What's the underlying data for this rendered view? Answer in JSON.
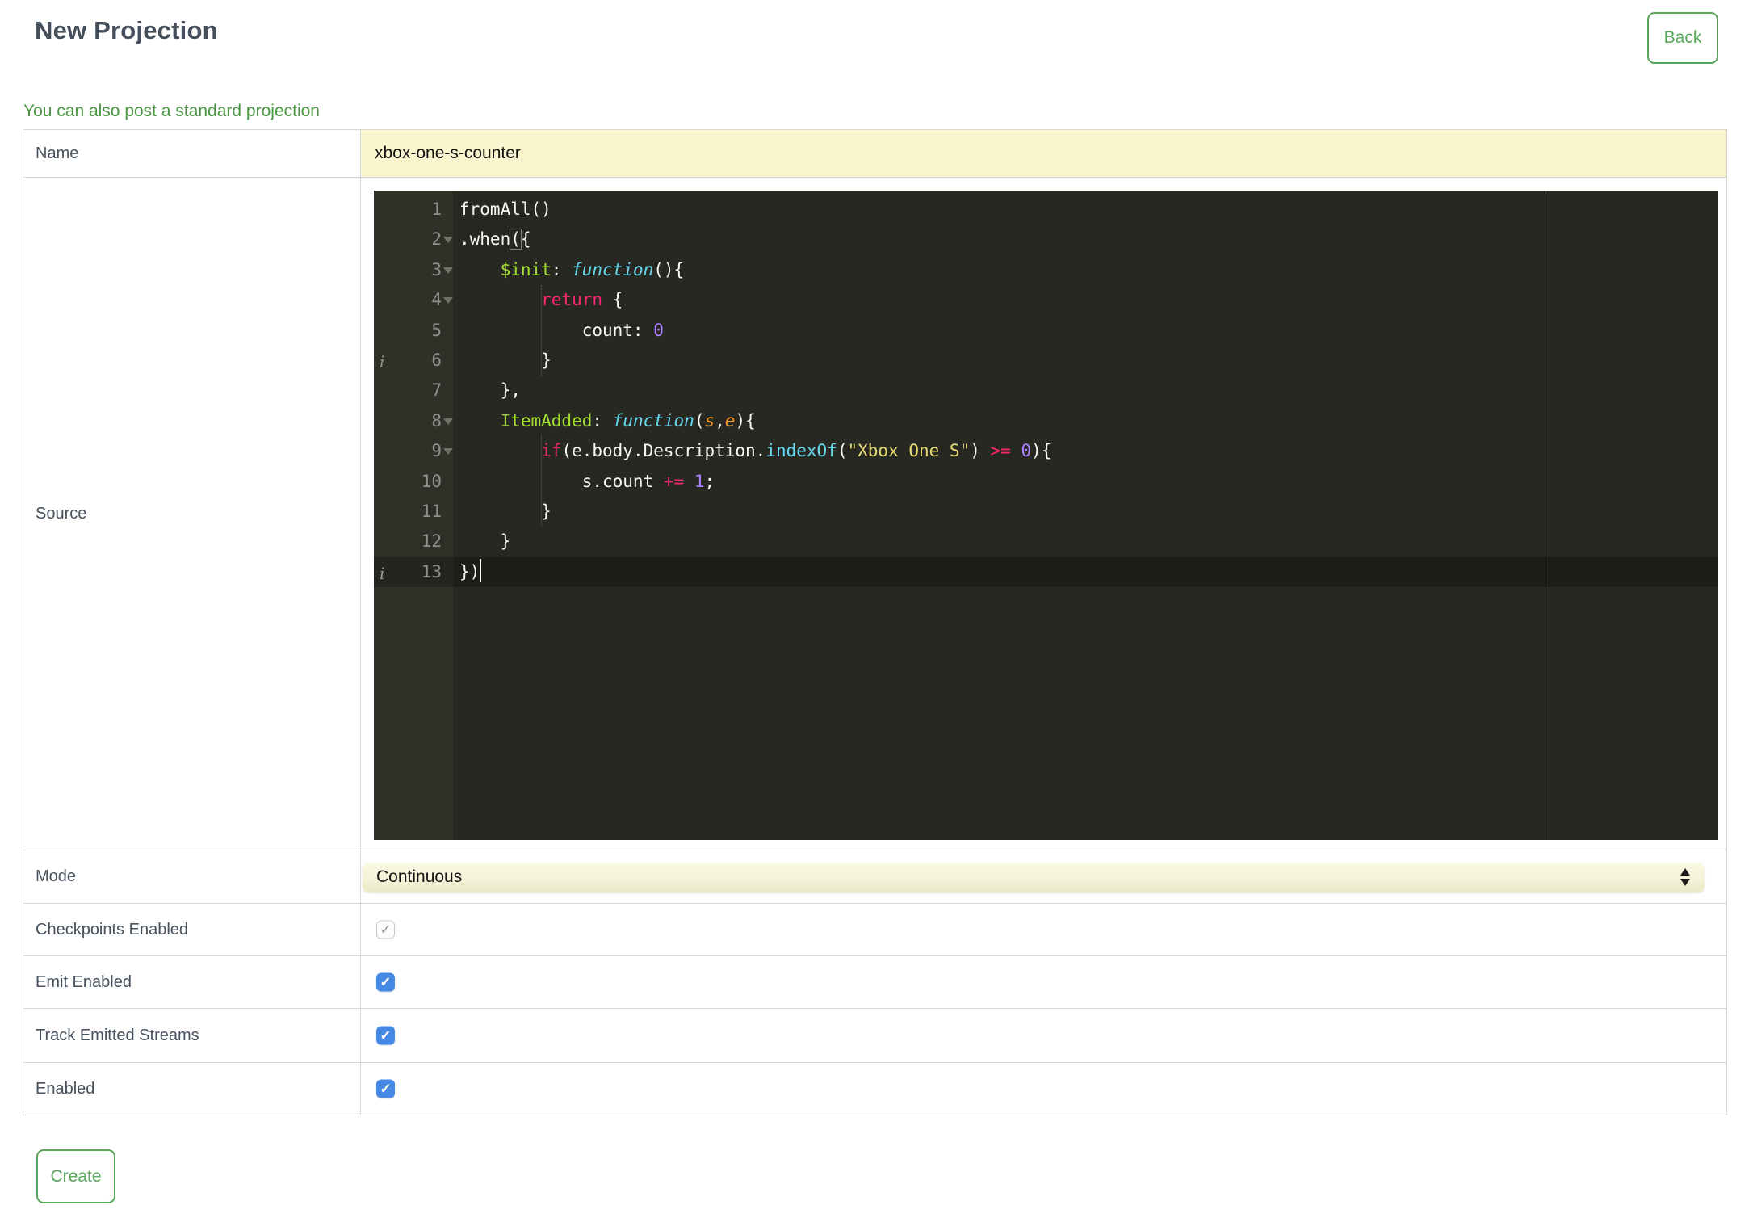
{
  "header": {
    "title": "New Projection",
    "back_label": "Back",
    "standard_projection_link": "You can also post a standard projection"
  },
  "form": {
    "name": {
      "label": "Name",
      "value": "xbox-one-s-counter"
    },
    "source": {
      "label": "Source"
    },
    "mode": {
      "label": "Mode",
      "value": "Continuous"
    },
    "checkpoints": {
      "label": "Checkpoints Enabled",
      "checked": true,
      "disabled": true
    },
    "emit": {
      "label": "Emit Enabled",
      "checked": true,
      "disabled": false
    },
    "track": {
      "label": "Track Emitted Streams",
      "checked": true,
      "disabled": false
    },
    "enabled": {
      "label": "Enabled",
      "checked": true,
      "disabled": false
    }
  },
  "footer": {
    "create_label": "Create"
  },
  "editor": {
    "active_line": 13,
    "check_glyph": "✓",
    "gutter": [
      {
        "n": "1"
      },
      {
        "n": "2",
        "fold": true
      },
      {
        "n": "3",
        "fold": true
      },
      {
        "n": "4",
        "fold": true
      },
      {
        "n": "5"
      },
      {
        "n": "6",
        "info": true
      },
      {
        "n": "7"
      },
      {
        "n": "8",
        "fold": true
      },
      {
        "n": "9",
        "fold": true
      },
      {
        "n": "10"
      },
      {
        "n": "11"
      },
      {
        "n": "12"
      },
      {
        "n": "13",
        "info": true
      }
    ],
    "lines": [
      [
        [
          "plain",
          "fromAll()"
        ]
      ],
      [
        [
          "plain",
          ".when"
        ],
        [
          "bracket",
          "("
        ],
        [
          "plain",
          "{"
        ]
      ],
      [
        [
          "plain",
          "    "
        ],
        [
          "entity",
          "$init"
        ],
        [
          "plain",
          ": "
        ],
        [
          "storage",
          "function"
        ],
        [
          "plain",
          "(){"
        ]
      ],
      [
        [
          "plain",
          "        "
        ],
        [
          "keyword",
          "return"
        ],
        [
          "plain",
          " {"
        ]
      ],
      [
        [
          "plain",
          "            count: "
        ],
        [
          "number",
          "0"
        ]
      ],
      [
        [
          "plain",
          "        }"
        ]
      ],
      [
        [
          "plain",
          "    },"
        ]
      ],
      [
        [
          "plain",
          "    "
        ],
        [
          "entity",
          "ItemAdded"
        ],
        [
          "plain",
          ": "
        ],
        [
          "storage",
          "function"
        ],
        [
          "plain",
          "("
        ],
        [
          "arg",
          "s"
        ],
        [
          "plain",
          ","
        ],
        [
          "arg",
          "e"
        ],
        [
          "plain",
          "){"
        ]
      ],
      [
        [
          "plain",
          "        "
        ],
        [
          "keyword",
          "if"
        ],
        [
          "plain",
          "(e.body.Description."
        ],
        [
          "support",
          "indexOf"
        ],
        [
          "plain",
          "("
        ],
        [
          "string",
          "\"Xbox One S\""
        ],
        [
          "plain",
          ") "
        ],
        [
          "keyword",
          ">="
        ],
        [
          "plain",
          " "
        ],
        [
          "number",
          "0"
        ],
        [
          "plain",
          "){"
        ]
      ],
      [
        [
          "plain",
          "            s.count "
        ],
        [
          "keyword",
          "+="
        ],
        [
          "plain",
          " "
        ],
        [
          "number",
          "1"
        ],
        [
          "plain",
          ";"
        ]
      ],
      [
        [
          "plain",
          "        }"
        ]
      ],
      [
        [
          "plain",
          "    }"
        ]
      ],
      [
        [
          "plain",
          "})"
        ],
        [
          "cursor",
          ""
        ]
      ]
    ],
    "colors": {
      "editor_background": "#272822",
      "gutter_background": "#2f3129",
      "text_default": "#f8f8f2",
      "keyword": "#f92672",
      "entity": "#a6e22e",
      "storage": "#66d9ef",
      "string": "#e6db74",
      "number": "#ae81ff",
      "argument": "#fd971f",
      "line_number": "#8f908a"
    }
  },
  "colors": {
    "accent_green": "#58a559",
    "link_green": "#4a9642",
    "input_yellow": "#faf5cf",
    "checkbox_blue": "#4589e5",
    "label_text": "#46515d",
    "title_text": "#454f5b",
    "table_border": "#d8d8d8"
  }
}
